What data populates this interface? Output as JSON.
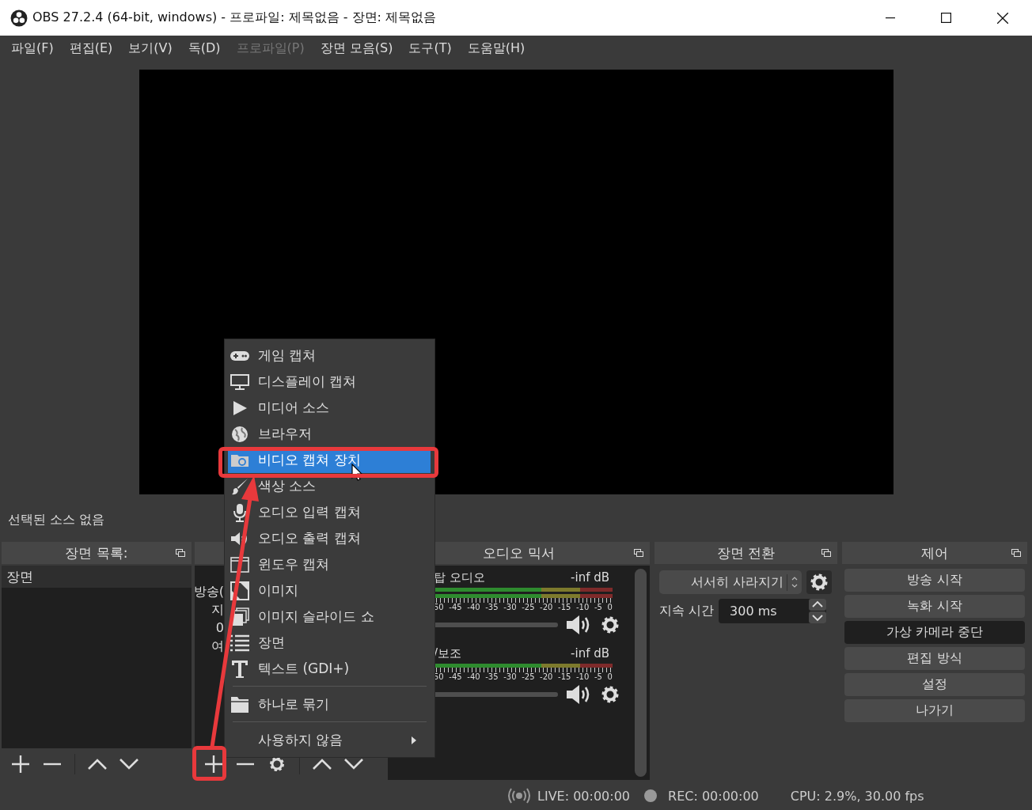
{
  "window": {
    "title": "OBS 27.2.4 (64-bit, windows) - 프로파일: 제목없음 - 장면: 제목없음"
  },
  "menubar": [
    {
      "label": "파일(F)",
      "disabled": false
    },
    {
      "label": "편집(E)",
      "disabled": false
    },
    {
      "label": "보기(V)",
      "disabled": false
    },
    {
      "label": "독(D)",
      "disabled": false
    },
    {
      "label": "프로파일(P)",
      "disabled": true
    },
    {
      "label": "장면 모음(S)",
      "disabled": false
    },
    {
      "label": "도구(T)",
      "disabled": false
    },
    {
      "label": "도움말(H)",
      "disabled": false
    }
  ],
  "selection_status": "선택된 소스 없음",
  "scenes_dock": {
    "title": "장면 목록:",
    "items": [
      {
        "label": "장면",
        "selected": true
      }
    ]
  },
  "sources_dock": {
    "partial_lines": [
      "방송(",
      "지",
      "0",
      "여"
    ]
  },
  "audio_mixer": {
    "title": "오디오 믹서",
    "channels": [
      {
        "name": "탑 오디오",
        "reading": "-inf dB",
        "level": 1,
        "stereo": true,
        "scale": [
          "50",
          "-45",
          "-40",
          "-35",
          "-30",
          "-25",
          "-20",
          "-15",
          "-10",
          "-5",
          "0"
        ]
      },
      {
        "name": "/보조",
        "reading": "-inf dB",
        "level": 1,
        "stereo": false,
        "scale": [
          "50",
          "-45",
          "-40",
          "-35",
          "-30",
          "-25",
          "-20",
          "-15",
          "-10",
          "-5",
          "0"
        ]
      }
    ]
  },
  "transitions_dock": {
    "title": "장면 전환",
    "transition": "서서히 사라지기",
    "duration_label": "지속 시간",
    "duration": "300 ms"
  },
  "controls_dock": {
    "title": "제어",
    "buttons": [
      {
        "label": "방송 시작",
        "active": false
      },
      {
        "label": "녹화 시작",
        "active": false
      },
      {
        "label": "가상 카메라 중단",
        "active": true
      },
      {
        "label": "편집 방식",
        "active": false
      },
      {
        "label": "설정",
        "active": false
      },
      {
        "label": "나가기",
        "active": false
      }
    ]
  },
  "add_source_menu": {
    "sections": [
      [
        {
          "kind": "game",
          "label": "게임 캡쳐",
          "selected": false
        },
        {
          "kind": "display",
          "label": "디스플레이 캡쳐",
          "selected": false
        },
        {
          "kind": "media",
          "label": "미디어 소스",
          "selected": false
        },
        {
          "kind": "browser",
          "label": "브라우저",
          "selected": false
        },
        {
          "kind": "video",
          "label": "비디오 캡쳐 장치",
          "selected": true
        },
        {
          "kind": "color",
          "label": "색상 소스",
          "selected": false
        },
        {
          "kind": "mic",
          "label": "오디오 입력 캡쳐",
          "selected": false
        },
        {
          "kind": "speaker",
          "label": "오디오 출력 캡쳐",
          "selected": false
        },
        {
          "kind": "window",
          "label": "윈도우 캡쳐",
          "selected": false
        },
        {
          "kind": "image",
          "label": "이미지",
          "selected": false
        },
        {
          "kind": "slideshow",
          "label": "이미지 슬라이드 쇼",
          "selected": false
        },
        {
          "kind": "scene",
          "label": "장면",
          "selected": false
        },
        {
          "kind": "text",
          "label": "텍스트 (GDI+)",
          "selected": false
        }
      ],
      [
        {
          "kind": "group",
          "label": "하나로 묶기",
          "selected": false
        }
      ],
      [
        {
          "kind": "submenu",
          "label": "사용하지 않음",
          "selected": false
        }
      ]
    ]
  },
  "status_bar": {
    "live": "LIVE: 00:00:00",
    "rec": "REC: 00:00:00",
    "cpu": "CPU: 2.9%, 30.00 fps"
  }
}
